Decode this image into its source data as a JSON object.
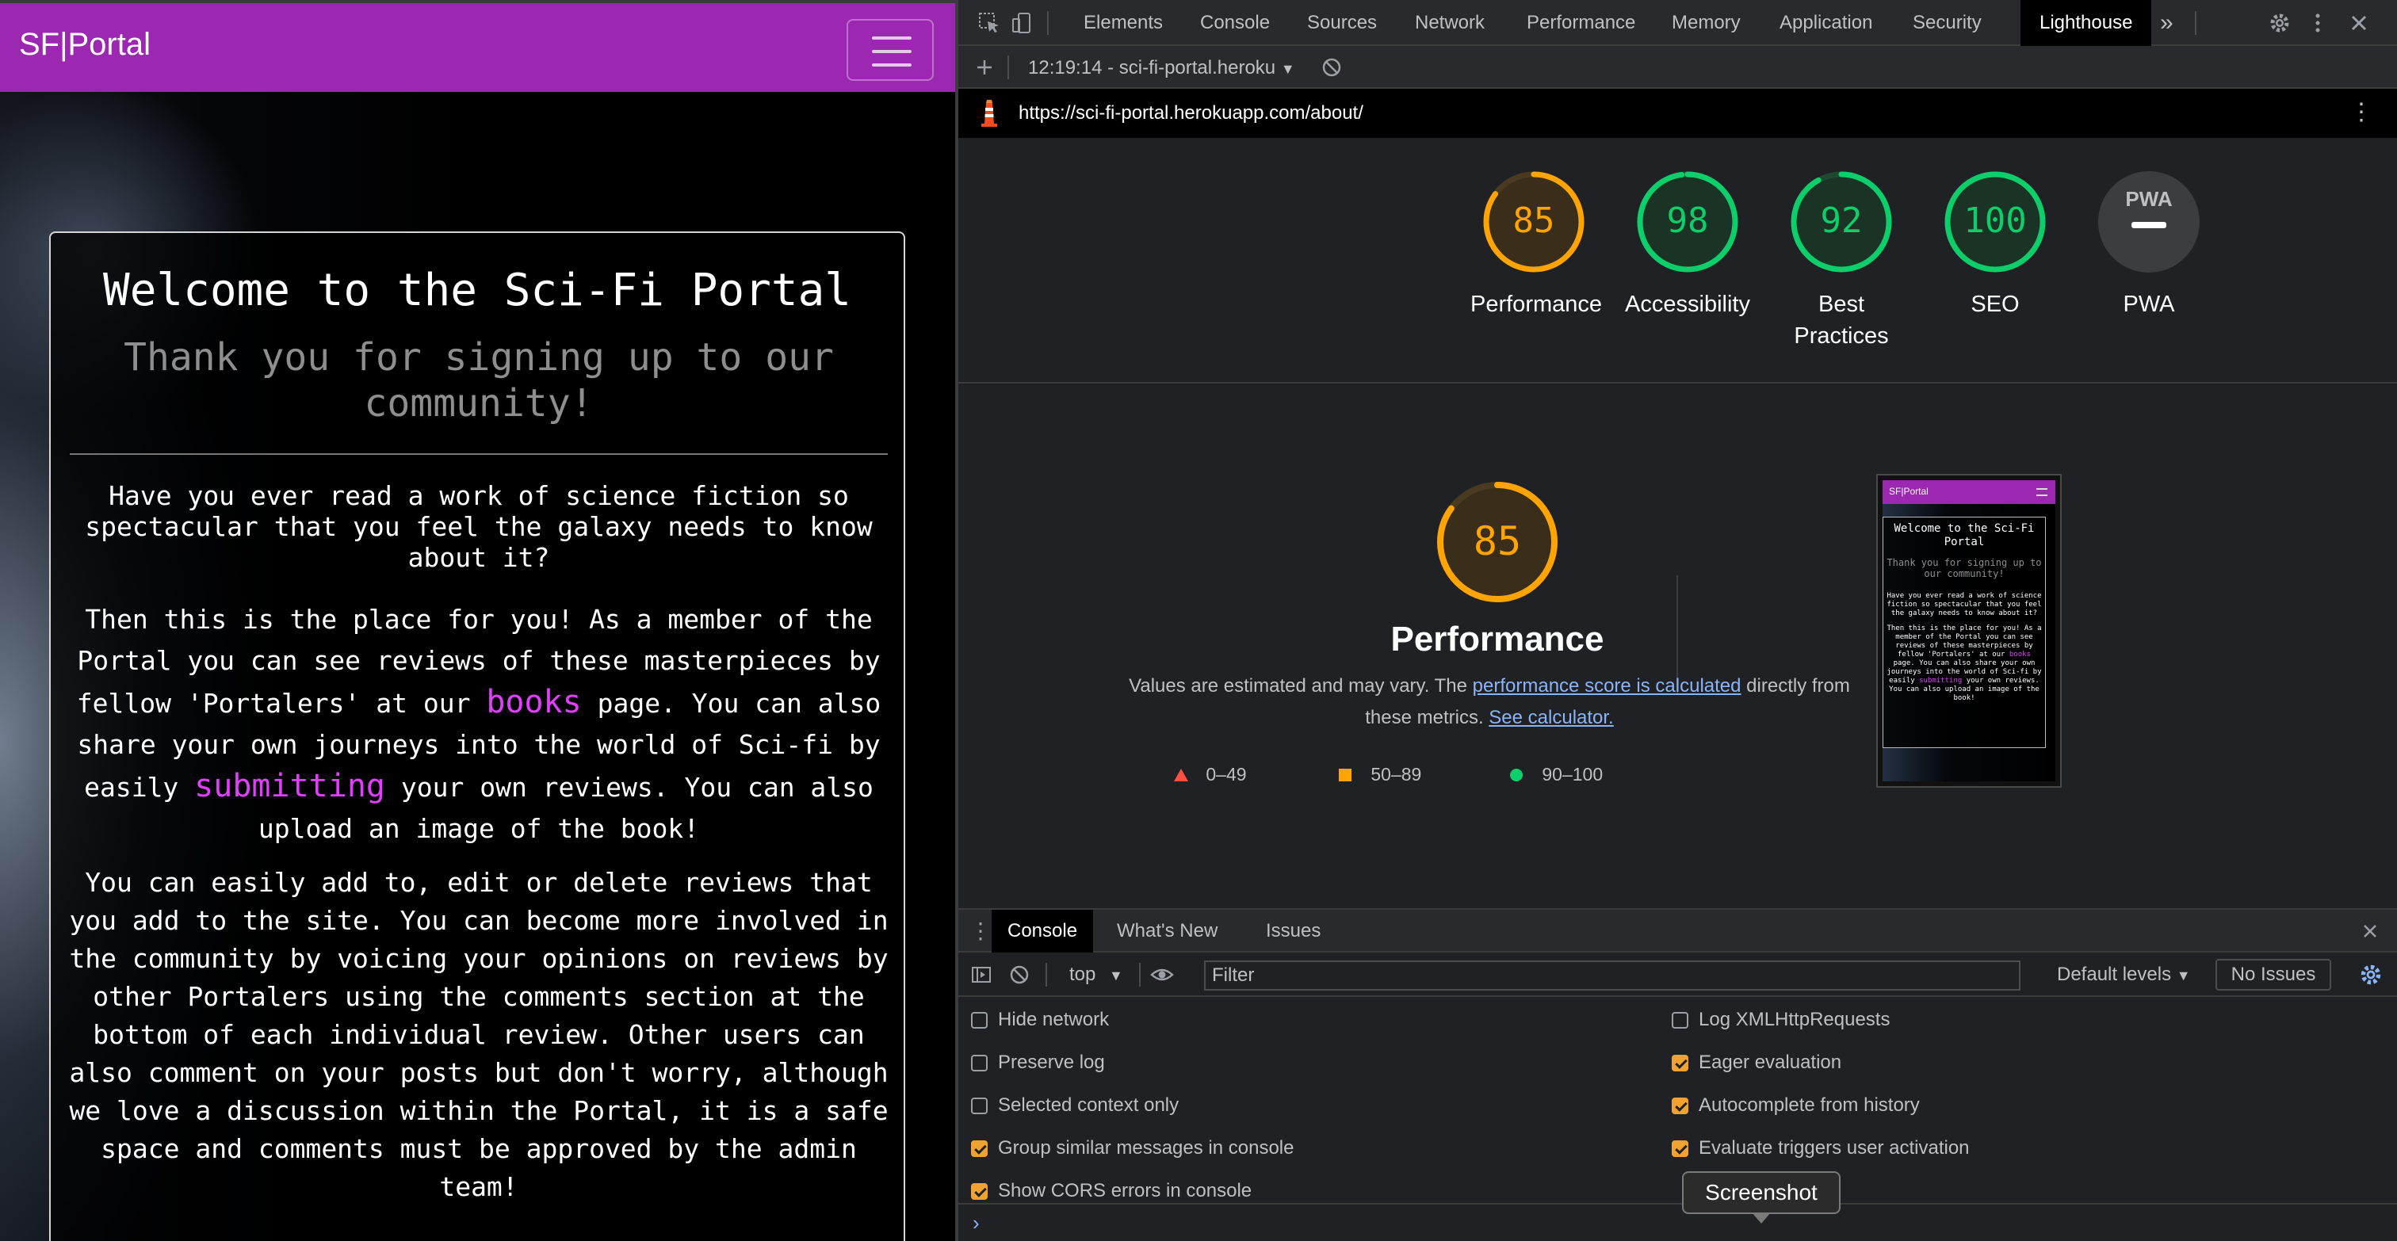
{
  "site": {
    "brand": "SF|Portal",
    "card": {
      "title": "Welcome to the Sci-Fi Portal",
      "subtitle": "Thank you for signing up to our community!",
      "para1": "Have you ever read a work of science fiction so spectacular that you feel the galaxy needs to know about it?",
      "para2": {
        "a": "Then this is the place for you! As a member of the Portal you can see reviews of these masterpieces by fellow 'Portalers' at our ",
        "link1": "books",
        "b": " page. You can also share your own journeys into the world of Sci-fi by easily ",
        "link2": "submitting",
        "c": " your own reviews. You can also upload an image of the book!"
      },
      "para3": "You can easily add to, edit or delete reviews that you add to the site. You can become more involved in the community by voicing your opinions on reviews by other Portalers using the comments section at the bottom of each individual review. Other users can also comment on your posts but don't worry, although we love a discussion within the Portal, it is a safe space and comments must be approved by the admin team!"
    }
  },
  "devtools": {
    "tabs": [
      "Elements",
      "Console",
      "Sources",
      "Network",
      "Performance",
      "Memory",
      "Application",
      "Security",
      "Lighthouse"
    ],
    "active_tab": "Lighthouse",
    "more_tabs": "»",
    "session": "12:19:14 - sci-fi-portal.heroku",
    "url": "https://sci-fi-portal.herokuapp.com/about/",
    "gauges": [
      {
        "score": "85",
        "label": "Performance",
        "value": 0.85,
        "color": "#ffa400"
      },
      {
        "score": "98",
        "label": "Accessibility",
        "value": 0.98,
        "color": "#0cce6b"
      },
      {
        "score": "92",
        "label": "Best Practices",
        "value": 0.92,
        "color": "#0cce6b"
      },
      {
        "score": "100",
        "label": "SEO",
        "value": 1.0,
        "color": "#0cce6b"
      }
    ],
    "pwa": {
      "badge": "PWA",
      "label": "PWA"
    },
    "perf": {
      "score": "85",
      "value": 0.85,
      "title": "Performance",
      "desc_a": "Values are estimated and may vary. The ",
      "desc_link1": "performance score is calculated",
      "desc_b": " directly from these metrics. ",
      "desc_link2": "See calculator.",
      "legend": [
        {
          "range": "0–49",
          "color": "#ff4e42",
          "shape": "triangle"
        },
        {
          "range": "50–89",
          "color": "#ffa400",
          "shape": "square"
        },
        {
          "range": "90–100",
          "color": "#0cce6b",
          "shape": "circle"
        }
      ]
    },
    "thumb": {
      "brand": "SF|Portal",
      "title": "Welcome to the Sci-Fi Portal",
      "subtitle": "Thank you for signing up to our community!",
      "p1": "Have you ever read a work of science fiction so spectacular that you feel the galaxy needs to know about it?",
      "p2a": "Then this is the place for you! As a member of the Portal you can see reviews of these masterpieces by fellow 'Portalers' at our ",
      "p2link1": "books",
      "p2b": " page. You can also share your own journeys into the world of Sci-fi by easily ",
      "p2link2": "submitting",
      "p2c": " your own reviews. You can also upload an image of the book!"
    },
    "drawer": {
      "tabs": [
        "Console",
        "What's New",
        "Issues"
      ],
      "context": "top",
      "filter_placeholder": "Filter",
      "levels": "Default levels",
      "issues": "No Issues",
      "options_left": [
        {
          "label": "Hide network",
          "checked": false
        },
        {
          "label": "Preserve log",
          "checked": false
        },
        {
          "label": "Selected context only",
          "checked": false
        },
        {
          "label": "Group similar messages in console",
          "checked": true
        },
        {
          "label": "Show CORS errors in console",
          "checked": true
        }
      ],
      "options_right": [
        {
          "label": "Log XMLHttpRequests",
          "checked": false
        },
        {
          "label": "Eager evaluation",
          "checked": true
        },
        {
          "label": "Autocomplete from history",
          "checked": true
        },
        {
          "label": "Evaluate triggers user activation",
          "checked": true
        }
      ]
    },
    "tooltip": "Screenshot"
  }
}
